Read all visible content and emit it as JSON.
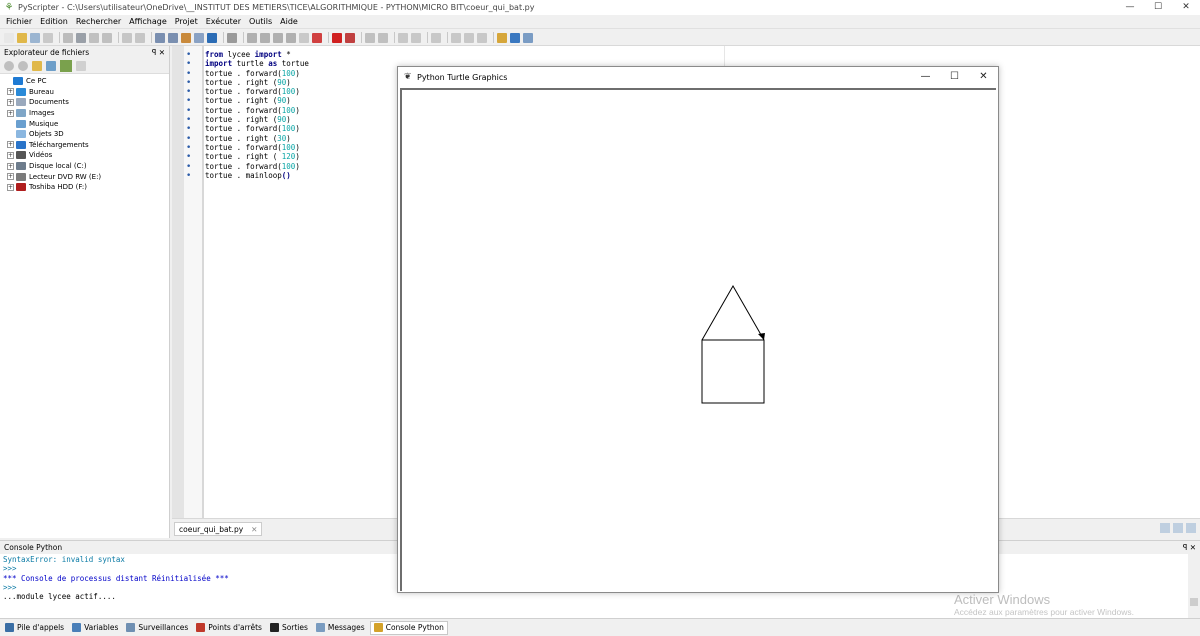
{
  "window": {
    "title": "PyScripter - C:\\Users\\utilisateur\\OneDrive\\__INSTITUT DES METIERS\\TICE\\ALGORITHMIQUE - PYTHON\\MICRO BIT\\coeur_qui_bat.py",
    "minimize": "—",
    "maximize": "☐",
    "close": "✕"
  },
  "menu": [
    "Fichier",
    "Edition",
    "Rechercher",
    "Affichage",
    "Projet",
    "Exécuter",
    "Outils",
    "Aide"
  ],
  "explorer": {
    "title": "Explorateur de fichiers",
    "pin": "ꟼ ✕",
    "items": [
      {
        "label": "Ce PC",
        "expandable": false,
        "color": "#1e7ad3"
      },
      {
        "label": "Bureau",
        "expandable": true,
        "color": "#2a8ad8"
      },
      {
        "label": "Documents",
        "expandable": true,
        "color": "#9aa9bd"
      },
      {
        "label": "Images",
        "expandable": true,
        "color": "#7fa6c7"
      },
      {
        "label": "Musique",
        "expandable": false,
        "color": "#6a9fcf"
      },
      {
        "label": "Objets 3D",
        "expandable": false,
        "color": "#8bb7e0"
      },
      {
        "label": "Téléchargements",
        "expandable": true,
        "color": "#2a74c9"
      },
      {
        "label": "Vidéos",
        "expandable": true,
        "color": "#555555"
      },
      {
        "label": "Disque local (C:)",
        "expandable": true,
        "color": "#6d7c8c"
      },
      {
        "label": "Lecteur DVD RW (E:)",
        "expandable": true,
        "color": "#7b7b7b"
      },
      {
        "label": "Toshiba HDD (F:)",
        "expandable": true,
        "color": "#b01e1e"
      }
    ]
  },
  "editor": {
    "code": [
      [
        "kw:from",
        " lycee ",
        "kw:import",
        " *"
      ],
      [
        "kw:import",
        " turtle ",
        "kw:as",
        " tortue"
      ],
      [
        "plain:tortue . forward(",
        "num:100",
        "plain:)"
      ],
      [
        "plain:tortue . right (",
        "num:90",
        "plain:)"
      ],
      [
        "plain:tortue . forward(",
        "num:100",
        "plain:)"
      ],
      [
        "plain:tortue . right (",
        "num:90",
        "plain:)"
      ],
      [
        "plain:tortue . forward(",
        "num:100",
        "plain:)"
      ],
      [
        "plain:tortue . right (",
        "num:90",
        "plain:)"
      ],
      [
        "plain:tortue . forward(",
        "num:100",
        "plain:)"
      ],
      [
        "plain:tortue . right (",
        "num:30",
        "plain:)"
      ],
      [
        "plain:tortue . forward(",
        "num:100",
        "plain:)"
      ],
      [
        "plain:tortue . right ( ",
        "num:120",
        "plain:)"
      ],
      [
        "plain:tortue . forward(",
        "num:100",
        "plain:)"
      ],
      [
        "plain:tortue . mainloop",
        "kw:()"
      ]
    ],
    "tab": "coeur_qui_bat.py",
    "tab_close": "✕"
  },
  "console": {
    "title": "Console Python",
    "pin": "ꟼ ✕",
    "lines": [
      {
        "text": "SyntaxError: invalid syntax",
        "style": "c-prompt"
      },
      {
        "text": ">>>",
        "style": "c-prompt"
      },
      {
        "text": "*** Console de processus distant Réinitialisée ***",
        "style": "c-blue"
      },
      {
        "text": ">>>",
        "style": "c-prompt"
      },
      {
        "text": "...module lycee actif....",
        "style": "c-dark"
      }
    ]
  },
  "watermark": {
    "line1": "Activer Windows",
    "line2": "Accédez aux paramètres pour activer Windows."
  },
  "bottom_tabs": [
    {
      "label": "Pile d'appels",
      "color": "#3a6ea5",
      "active": false
    },
    {
      "label": "Variables",
      "color": "#4a7fb8",
      "active": false
    },
    {
      "label": "Surveillances",
      "color": "#6f8fb2",
      "active": false
    },
    {
      "label": "Points d'arrêts",
      "color": "#c0392b",
      "active": false
    },
    {
      "label": "Sorties",
      "color": "#222222",
      "active": false
    },
    {
      "label": "Messages",
      "color": "#7a9cc0",
      "active": false
    },
    {
      "label": "Console Python",
      "color": "#d4a22a",
      "active": true
    }
  ],
  "turtle_window": {
    "title": "Python Turtle Graphics",
    "minimize": "—",
    "maximize": "☐",
    "close": "✕",
    "drawing_color": "#000000"
  }
}
